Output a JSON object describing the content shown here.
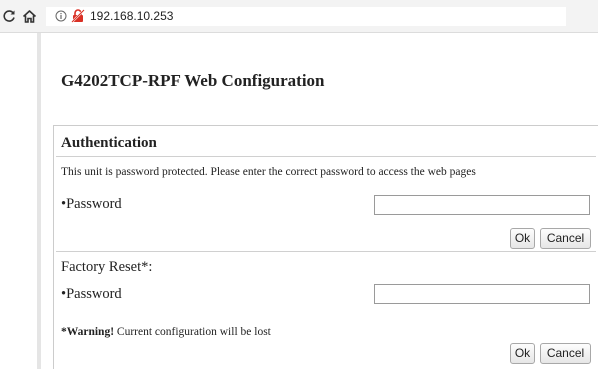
{
  "browser": {
    "url": "192.168.10.253",
    "icons": [
      "reload-icon",
      "home-icon",
      "info-icon",
      "not-secure-icon"
    ]
  },
  "page": {
    "title": "G4202TCP-RPF Web Configuration"
  },
  "authentication": {
    "title": "Authentication",
    "notice": "This unit is password protected. Please enter the correct password to access the web pages",
    "password_label": "•Password",
    "password_value": "",
    "ok_label": "Ok",
    "cancel_label": "Cancel"
  },
  "factory_reset": {
    "title": "Factory Reset*:",
    "password_label": "•Password",
    "password_value": "",
    "warning_bold": "*Warning!",
    "warning_text": " Current configuration will be lost",
    "ok_label": "Ok",
    "cancel_label": "Cancel"
  },
  "colors": {
    "chrome_bg": "#f3f3f3",
    "insecure_red": "#d93025",
    "text": "#222222",
    "divider": "#d0d0d0"
  }
}
